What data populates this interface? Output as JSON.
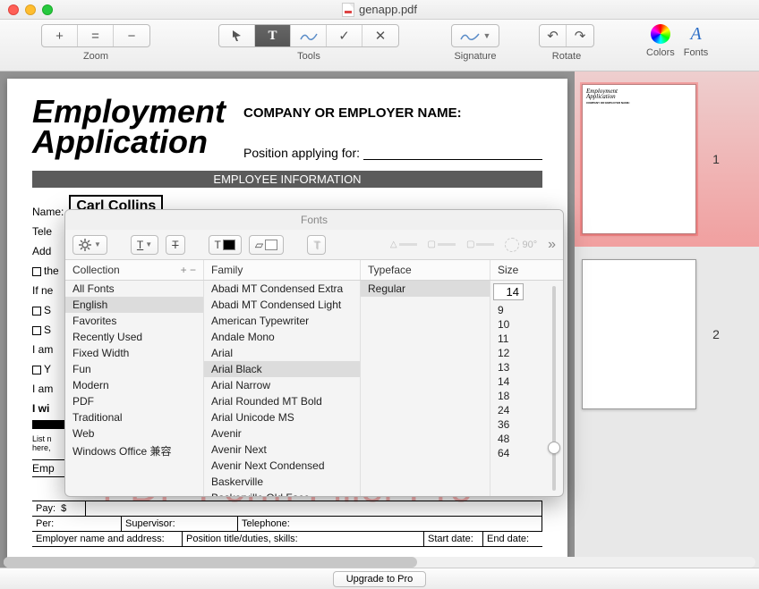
{
  "window": {
    "title": "genapp.pdf"
  },
  "toolbar": {
    "zoom_label": "Zoom",
    "tools_label": "Tools",
    "signature_label": "Signature",
    "rotate_label": "Rotate",
    "colors_label": "Colors",
    "fonts_label": "Fonts",
    "zoom_plus": "+",
    "zoom_fit": "=",
    "zoom_minus": "−",
    "tool_text": "T",
    "tool_check": "✓",
    "tool_x": "✕",
    "signature_glyph": "✎",
    "rotate_left": "↶",
    "rotate_right": "↷",
    "fonts_glyph": "A"
  },
  "document": {
    "title_line1": "Employment",
    "title_line2": "Application",
    "company_label": "COMPANY OR EMPLOYER NAME:",
    "position_label": "Position applying for:",
    "section_empinfo": "EMPLOYEE INFORMATION",
    "name_label": "Name:",
    "name_value": "Carl Collins",
    "tel_label": "Tele",
    "addr_label": "Add",
    "the_label": "the",
    "ifne_label": "If ne",
    "iam1": "I am",
    "iam2": "I am",
    "iwi": "I wi",
    "list_label": "List n\nhere,",
    "emp_label": "Emp",
    "pay_label": "Pay:",
    "pay_value": "$",
    "per_label": "Per:",
    "supervisor_label": "Supervisor:",
    "telephone_label": "Telephone:",
    "employer_addr_label": "Employer name and address:",
    "position_title_label": "Position title/duties, skills:",
    "start_date_label": "Start date:",
    "end_date_label": "End date:",
    "watermark": "PDF-Form-Filler Pro"
  },
  "thumbnails": {
    "page1": "1",
    "page2": "2"
  },
  "footer": {
    "upgrade_label": "Upgrade to Pro"
  },
  "fonts_panel": {
    "title": "Fonts",
    "underline_glyph": "T",
    "strike_glyph": "T",
    "textcolor_glyph": "T",
    "doccolor_glyph": "▱",
    "shadow_glyph": "T",
    "angle_label": "90°",
    "more_glyph": "»",
    "col_collection": "Collection",
    "col_family": "Family",
    "col_typeface": "Typeface",
    "col_size": "Size",
    "add_glyph": "+",
    "remove_glyph": "−",
    "collections": [
      "All Fonts",
      "English",
      "Favorites",
      "Recently Used",
      "Fixed Width",
      "Fun",
      "Modern",
      "PDF",
      "Traditional",
      "Web",
      "Windows Office 兼容"
    ],
    "collection_selected": "English",
    "families": [
      "Abadi MT Condensed Extra",
      "Abadi MT Condensed Light",
      "American Typewriter",
      "Andale Mono",
      "Arial",
      "Arial Black",
      "Arial Narrow",
      "Arial Rounded MT Bold",
      "Arial Unicode MS",
      "Avenir",
      "Avenir Next",
      "Avenir Next Condensed",
      "Baskerville",
      "Baskerville Old Face"
    ],
    "family_selected": "Arial Black",
    "typefaces": [
      "Regular"
    ],
    "typeface_selected": "Regular",
    "size_value": "14",
    "sizes": [
      "9",
      "10",
      "11",
      "12",
      "13",
      "14",
      "18",
      "24",
      "36",
      "48",
      "64"
    ],
    "size_selected": "14"
  }
}
